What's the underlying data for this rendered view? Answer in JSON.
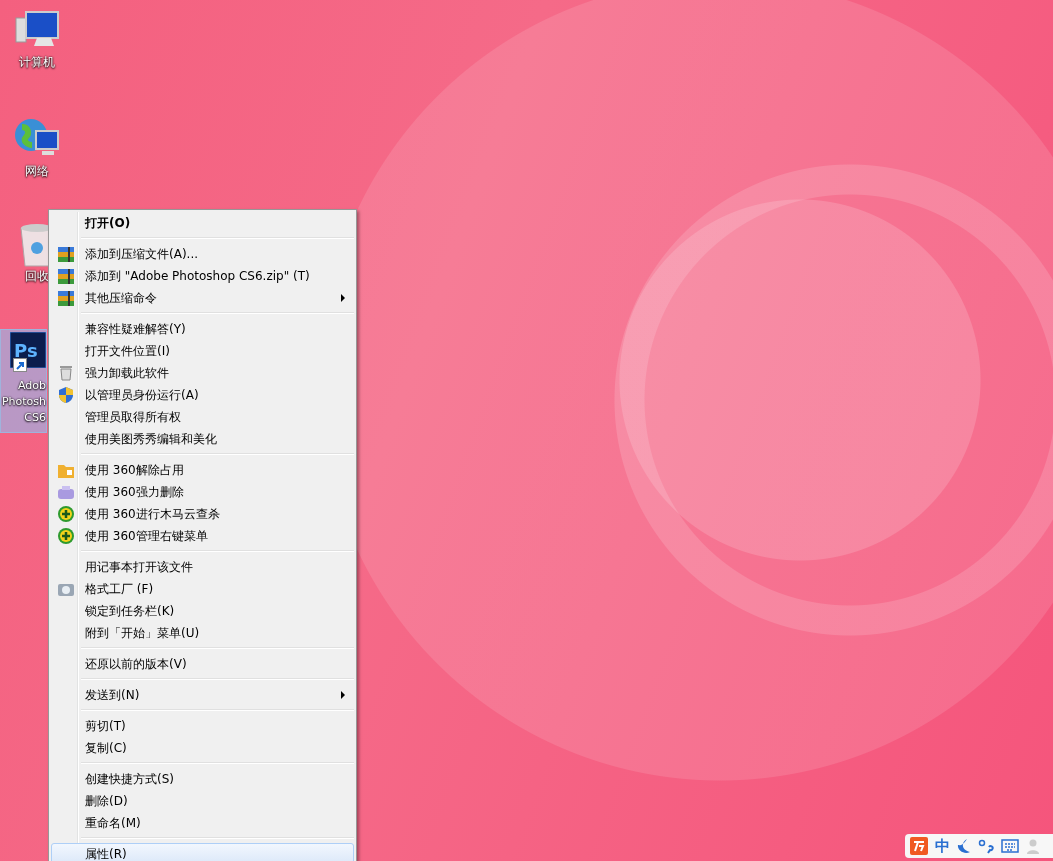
{
  "desktop_icons": [
    {
      "kind": "computer",
      "label_lines": [
        "计算机"
      ],
      "selected": false,
      "shortcut": false
    },
    {
      "kind": "network",
      "label_lines": [
        "网络"
      ],
      "selected": false,
      "shortcut": false
    },
    {
      "kind": "recycle",
      "label_lines": [
        "回收"
      ],
      "selected": false,
      "shortcut": false
    },
    {
      "kind": "photoshop",
      "logo_text": "Ps",
      "label_lines": [
        "Adob",
        "Photosh",
        "CS6"
      ],
      "selected": true,
      "shortcut": true
    }
  ],
  "context_menu": {
    "groups": [
      [
        {
          "kind": "plain",
          "label": "打开(O)",
          "bold": true,
          "submenu": false,
          "selected": false
        }
      ],
      [
        {
          "kind": "archive",
          "label": "添加到压缩文件(A)...",
          "bold": false,
          "submenu": false,
          "selected": false
        },
        {
          "kind": "archive",
          "label": "添加到 \"Adobe Photoshop CS6.zip\" (T)",
          "bold": false,
          "submenu": false,
          "selected": false
        },
        {
          "kind": "archive",
          "label": "其他压缩命令",
          "bold": false,
          "submenu": true,
          "selected": false
        }
      ],
      [
        {
          "kind": "plain",
          "label": "兼容性疑难解答(Y)",
          "bold": false,
          "submenu": false,
          "selected": false
        },
        {
          "kind": "plain",
          "label": "打开文件位置(I)",
          "bold": false,
          "submenu": false,
          "selected": false
        },
        {
          "kind": "trash",
          "label": "强力卸载此软件",
          "bold": false,
          "submenu": false,
          "selected": false
        },
        {
          "kind": "shield",
          "label": "以管理员身份运行(A)",
          "bold": false,
          "submenu": false,
          "selected": false
        },
        {
          "kind": "plain",
          "label": "管理员取得所有权",
          "bold": false,
          "submenu": false,
          "selected": false
        },
        {
          "kind": "plain",
          "label": "使用美图秀秀编辑和美化",
          "bold": false,
          "submenu": false,
          "selected": false
        }
      ],
      [
        {
          "kind": "folder",
          "label": "使用 360解除占用",
          "bold": false,
          "submenu": false,
          "selected": false
        },
        {
          "kind": "eraser",
          "label": "使用 360强力删除",
          "bold": false,
          "submenu": false,
          "selected": false
        },
        {
          "kind": "plus",
          "label": "使用 360进行木马云查杀",
          "bold": false,
          "submenu": false,
          "selected": false
        },
        {
          "kind": "plus",
          "label": "使用 360管理右键菜单",
          "bold": false,
          "submenu": false,
          "selected": false
        }
      ],
      [
        {
          "kind": "plain",
          "label": "用记事本打开该文件",
          "bold": false,
          "submenu": false,
          "selected": false
        },
        {
          "kind": "camera",
          "label": "格式工厂 (F)",
          "bold": false,
          "submenu": false,
          "selected": false
        },
        {
          "kind": "plain",
          "label": "锁定到任务栏(K)",
          "bold": false,
          "submenu": false,
          "selected": false
        },
        {
          "kind": "plain",
          "label": "附到「开始」菜单(U)",
          "bold": false,
          "submenu": false,
          "selected": false
        }
      ],
      [
        {
          "kind": "plain",
          "label": "还原以前的版本(V)",
          "bold": false,
          "submenu": false,
          "selected": false
        }
      ],
      [
        {
          "kind": "plain",
          "label": "发送到(N)",
          "bold": false,
          "submenu": true,
          "selected": false
        }
      ],
      [
        {
          "kind": "plain",
          "label": "剪切(T)",
          "bold": false,
          "submenu": false,
          "selected": false
        },
        {
          "kind": "plain",
          "label": "复制(C)",
          "bold": false,
          "submenu": false,
          "selected": false
        }
      ],
      [
        {
          "kind": "plain",
          "label": "创建快捷方式(S)",
          "bold": false,
          "submenu": false,
          "selected": false
        },
        {
          "kind": "plain",
          "label": "删除(D)",
          "bold": false,
          "submenu": false,
          "selected": false
        },
        {
          "kind": "plain",
          "label": "重命名(M)",
          "bold": false,
          "submenu": false,
          "selected": false
        }
      ],
      [
        {
          "kind": "plain",
          "label": "属性(R)",
          "bold": false,
          "submenu": false,
          "selected": true
        }
      ]
    ]
  },
  "ime_bar": {
    "mode": "中"
  }
}
